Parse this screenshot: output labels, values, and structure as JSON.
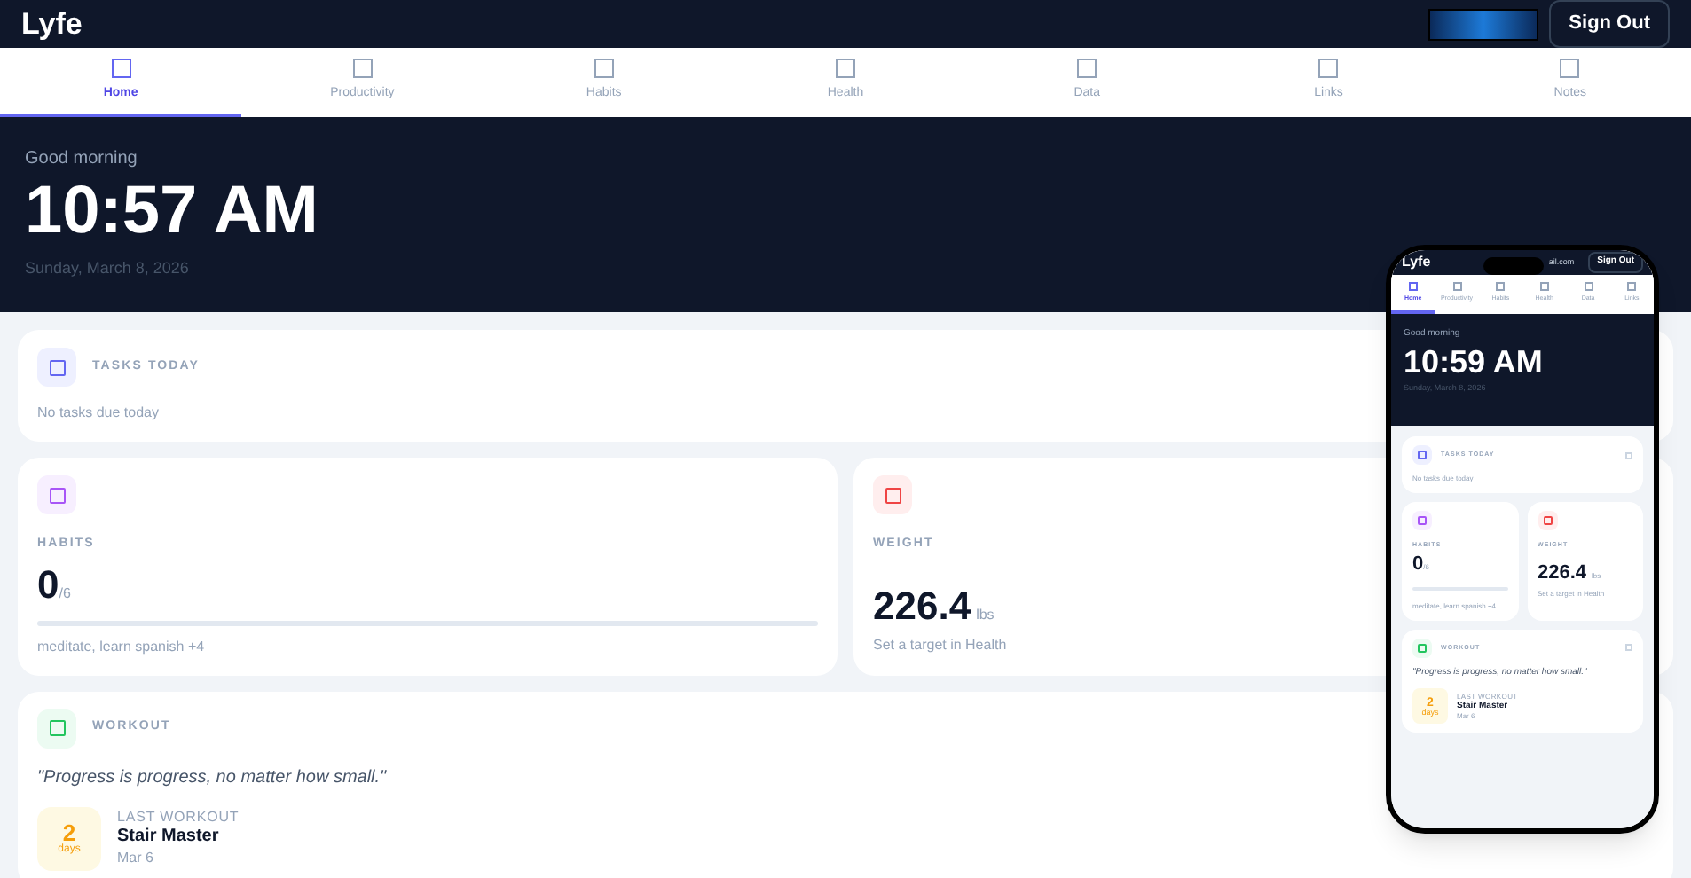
{
  "header": {
    "logo": "Lyfe",
    "sign_out": "Sign Out"
  },
  "tabs": [
    {
      "label": "Home",
      "selected": true
    },
    {
      "label": "Productivity",
      "selected": false
    },
    {
      "label": "Habits",
      "selected": false
    },
    {
      "label": "Health",
      "selected": false
    },
    {
      "label": "Data",
      "selected": false
    },
    {
      "label": "Links",
      "selected": false
    },
    {
      "label": "Notes",
      "selected": false
    }
  ],
  "hero": {
    "greeting": "Good morning",
    "time": "10:57 AM",
    "date": "Sunday, March 8, 2026"
  },
  "tasks": {
    "title": "TASKS TODAY",
    "empty": "No tasks due today"
  },
  "habits": {
    "title": "HABITS",
    "count": "0",
    "total": "/6",
    "level": 0,
    "names": "meditate, learn spanish +4"
  },
  "weight": {
    "title": "WEIGHT",
    "value": "226.4",
    "unit": "lbs",
    "hint": "Set a target in Health"
  },
  "workout": {
    "title": "WORKOUT",
    "quote": "\"Progress is progress, no matter how small.\"",
    "days": "2",
    "days_label": "days",
    "last_label": "LAST WORKOUT",
    "name": "Stair Master",
    "date": "Mar 6"
  },
  "phone": {
    "header": {
      "logo": "Lyfe",
      "email": "ail.com",
      "sign_out": "Sign Out"
    },
    "tabs": [
      {
        "label": "Home",
        "selected": true
      },
      {
        "label": "Productivity",
        "selected": false
      },
      {
        "label": "Habits",
        "selected": false
      },
      {
        "label": "Health",
        "selected": false
      },
      {
        "label": "Data",
        "selected": false
      },
      {
        "label": "Links",
        "selected": false
      }
    ],
    "hero": {
      "greeting": "Good morning",
      "time": "10:59 AM",
      "date": "Sunday, March 8, 2026"
    },
    "tasks": {
      "title": "TASKS TODAY",
      "empty": "No tasks due today"
    },
    "habits": {
      "title": "HABITS",
      "count": "0",
      "total": "/6",
      "level": 0,
      "names": "meditate, learn spanish +4"
    },
    "weight": {
      "title": "WEIGHT",
      "value": "226.4",
      "unit": "lbs",
      "hint": "Set a target in Health"
    },
    "workout": {
      "title": "WORKOUT",
      "quote": "\"Progress is progress, no matter how small.\"",
      "days": "2",
      "days_label": "days",
      "last_label": "LAST WORKOUT",
      "name": "Stair Master",
      "date": "Mar 6"
    }
  }
}
